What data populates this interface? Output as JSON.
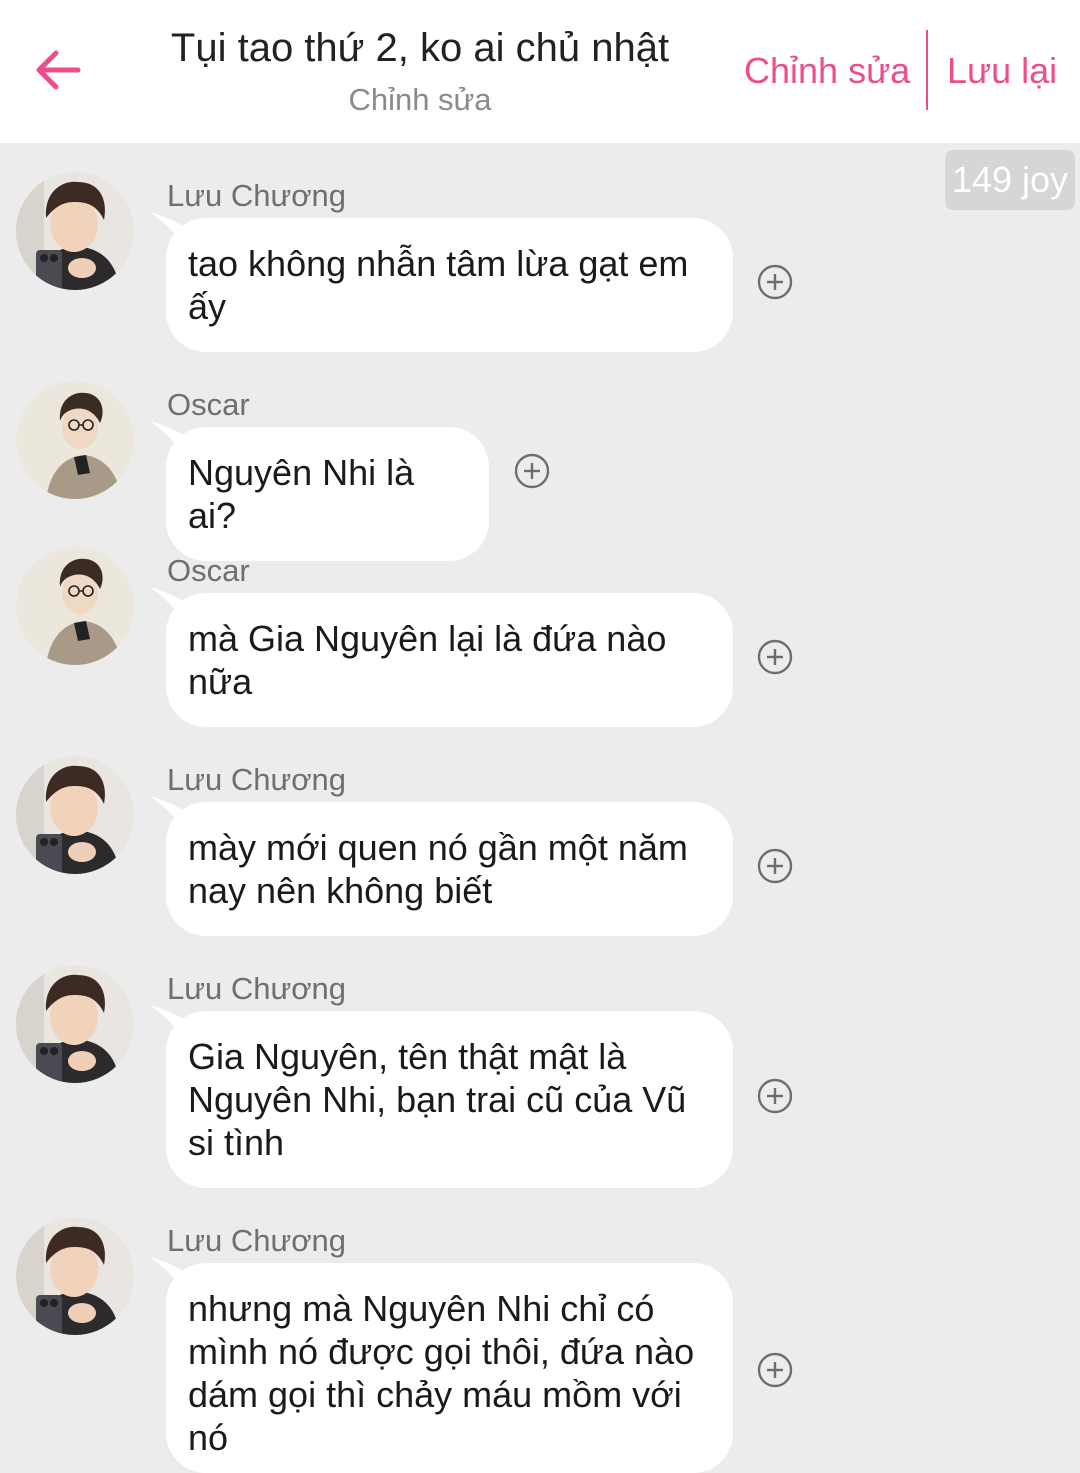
{
  "header": {
    "title": "Tụi tao thứ 2, ko ai chủ nhật",
    "subtitle": "Chỉnh sửa",
    "edit_label": "Chỉnh sửa",
    "save_label": "Lưu lại",
    "accent_color": "#ee4d8c"
  },
  "joy_badge": "149 joy",
  "messages": [
    {
      "sender": "Lưu Chương",
      "text": "tao không nhẫn tâm lừa gạt em ấy",
      "avatar": "luu-chuong-avatar"
    },
    {
      "sender": "Oscar",
      "text": "Nguyên Nhi là ai?",
      "avatar": "oscar-avatar"
    },
    {
      "sender": "Oscar",
      "text": "mà Gia Nguyên lại là đứa nào nữa",
      "avatar": "oscar-avatar"
    },
    {
      "sender": "Lưu Chương",
      "text": "mày mới quen nó gần một năm nay nên không biết",
      "avatar": "luu-chuong-avatar"
    },
    {
      "sender": "Lưu Chương",
      "text": "Gia Nguyên, tên thật mật là Nguyên Nhi, bạn trai cũ của Vũ si tình",
      "avatar": "luu-chuong-avatar"
    },
    {
      "sender": "Lưu Chương",
      "text": "nhưng mà Nguyên Nhi chỉ có mình nó được gọi thôi, đứa nào dám gọi thì chảy máu mồm với nó",
      "avatar": "luu-chuong-avatar"
    }
  ]
}
